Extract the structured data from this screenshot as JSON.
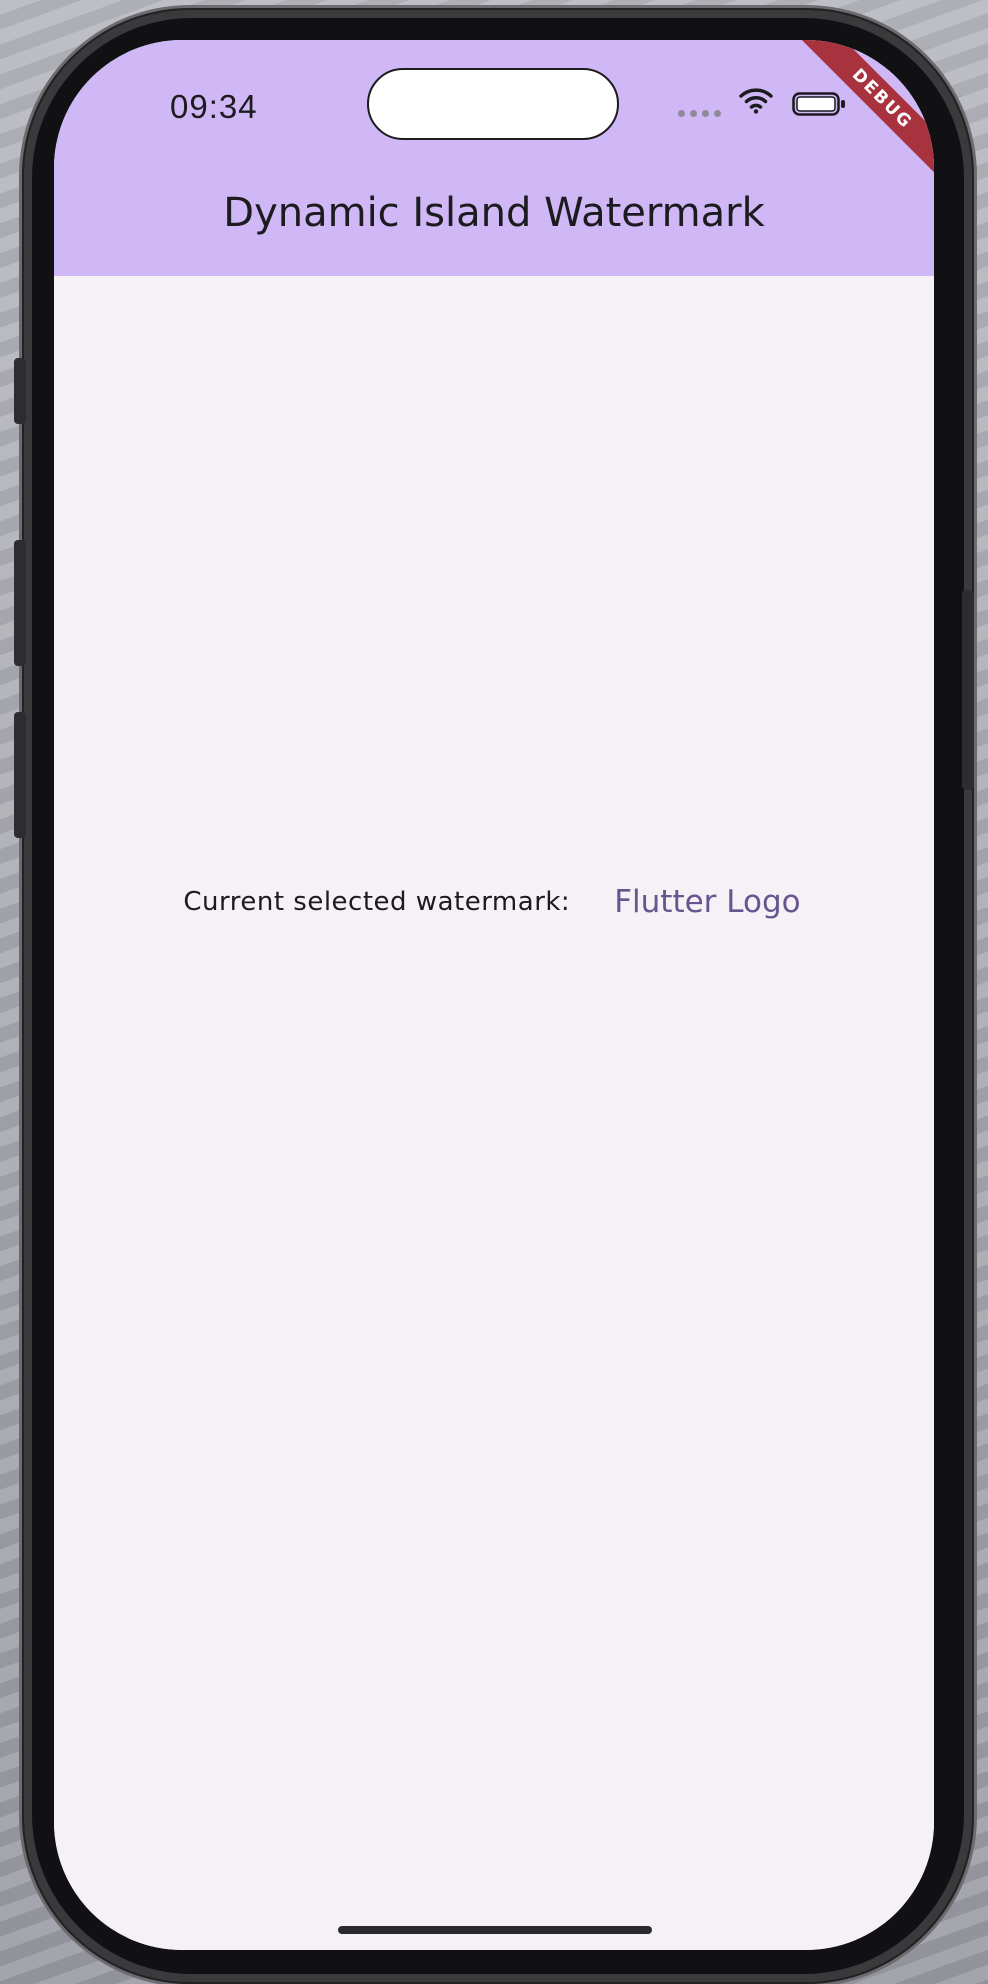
{
  "status_bar": {
    "time": "09:34",
    "wifi_icon": "wifi-icon",
    "battery_icon": "battery-icon"
  },
  "debug_banner": {
    "label": "DEBUG",
    "color": "#a8333f"
  },
  "app_bar": {
    "title": "Dynamic Island Watermark",
    "background": "#cfb8f5"
  },
  "content": {
    "watermark_label": "Current selected watermark:",
    "watermark_value": "Flutter Logo",
    "accent": "#66558f",
    "background": "#f5f1f6"
  }
}
